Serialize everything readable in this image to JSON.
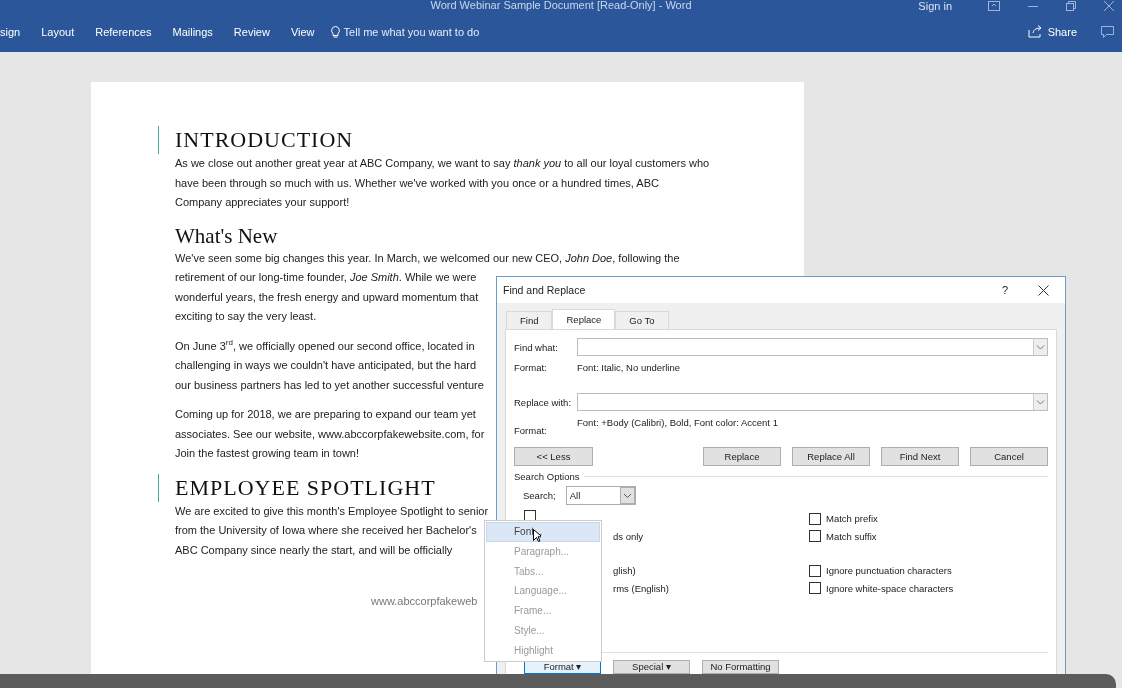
{
  "window": {
    "title": "Word Webinar Sample Document [Read-Only]  -  Word",
    "sign_in": "Sign in"
  },
  "ribbon": {
    "tabs": [
      {
        "label": "sign",
        "selected": false
      },
      {
        "label": "Layout",
        "selected": false
      },
      {
        "label": "References",
        "selected": false
      },
      {
        "label": "Mailings",
        "selected": false
      },
      {
        "label": "Review",
        "selected": false
      },
      {
        "label": "View",
        "selected": false
      }
    ],
    "tell_me": "Tell me what you want to do",
    "share": "Share"
  },
  "document": {
    "blocks": [
      {
        "kind": "heading1",
        "text": "INTRODUCTION"
      },
      {
        "kind": "paragraph",
        "lines": [
          "As we close out another great year at ABC Company, we want to say *thank you* to all our loyal customers who",
          "have been through so much with us. Whether we've worked with you once or a hundred times, ABC",
          "Company appreciates your support!"
        ]
      },
      {
        "kind": "heading2",
        "text": "What's New"
      },
      {
        "kind": "paragraph",
        "lines": [
          "We've seen some big changes this year. In March, we welcomed our new CEO, *John Doe*, following the",
          "retirement of our long-time founder, *Joe Smith*. While we were",
          "wonderful years, the fresh energy and upward momentum that",
          "exciting to say the very least."
        ]
      },
      {
        "kind": "paragraph",
        "lines": [
          "On June 3$^{rd}$, we officially opened our second office, located in",
          "challenging in ways we couldn't have anticipated, but the hard",
          "our business partners has led to yet another successful venture"
        ]
      },
      {
        "kind": "paragraph",
        "lines": [
          "Coming up for 2018, we are preparing to expand our team yet",
          "associates. See our website, www.abccorpfakewebsite.com, for",
          "Join the fastest growing team in town!"
        ]
      },
      {
        "kind": "heading1",
        "text": "EMPLOYEE SPOTLIGHT"
      },
      {
        "kind": "paragraph",
        "lines": [
          "We are excited to give this month's Employee Spotlight to senior",
          "from the University of Iowa where she received her Bachelor's",
          "ABC Company since nearly the start, and will be officially"
        ]
      }
    ],
    "footer": "www.abccorpfakeweb"
  },
  "dialog": {
    "title": "Find and Replace",
    "help": "?",
    "tabs": [
      {
        "label": "Find",
        "selected": false
      },
      {
        "label": "Replace",
        "selected": true
      },
      {
        "label": "Go To",
        "selected": false
      }
    ],
    "find_label": "Find what:",
    "find_format_label": "Format:",
    "find_format": "Font: Italic, No underline",
    "replace_label": "Replace with:",
    "replace_format_label": "Format:",
    "replace_format": "Font: +Body (Calibri), Bold, Font color: Accent 1",
    "less_button": "<< Less",
    "buttons": [
      "Replace",
      "Replace All",
      "Find Next",
      "Cancel"
    ],
    "search_options": "Search Options",
    "search_label": "Search;",
    "search_value": "All",
    "options": [
      {
        "kind": "covered_checkbox",
        "checked": false
      },
      {
        "kind": "checkbox",
        "label": "Match prefix",
        "checked": false
      },
      {
        "kind": "fragment",
        "label": "ds only"
      },
      {
        "kind": "checkbox",
        "label": "Match suffix",
        "checked": false
      },
      {
        "kind": "gap"
      },
      {
        "kind": "gap"
      },
      {
        "kind": "fragment",
        "label": "glish)"
      },
      {
        "kind": "checkbox",
        "label": "Ignore punctuation characters",
        "checked": false
      },
      {
        "kind": "fragment",
        "label": "rms (English)"
      },
      {
        "kind": "checkbox",
        "label": "Ignore white-space characters",
        "checked": false
      }
    ],
    "bottom_buttons": [
      {
        "label": "Format ▾",
        "selected": true
      },
      {
        "label": "Special ▾",
        "selected": false
      },
      {
        "label": "No Formatting",
        "selected": false
      }
    ]
  },
  "format_menu": {
    "items": [
      {
        "label": "Font...",
        "selected": true,
        "disabled": false
      },
      {
        "label": "Paragraph...",
        "selected": false,
        "disabled": true
      },
      {
        "label": "Tabs...",
        "selected": false,
        "disabled": true
      },
      {
        "label": "Language...",
        "selected": false,
        "disabled": true
      },
      {
        "label": "Frame...",
        "selected": false,
        "disabled": true
      },
      {
        "label": "Style...",
        "selected": false,
        "disabled": true
      },
      {
        "label": "Highlight",
        "selected": false,
        "disabled": true
      }
    ]
  }
}
